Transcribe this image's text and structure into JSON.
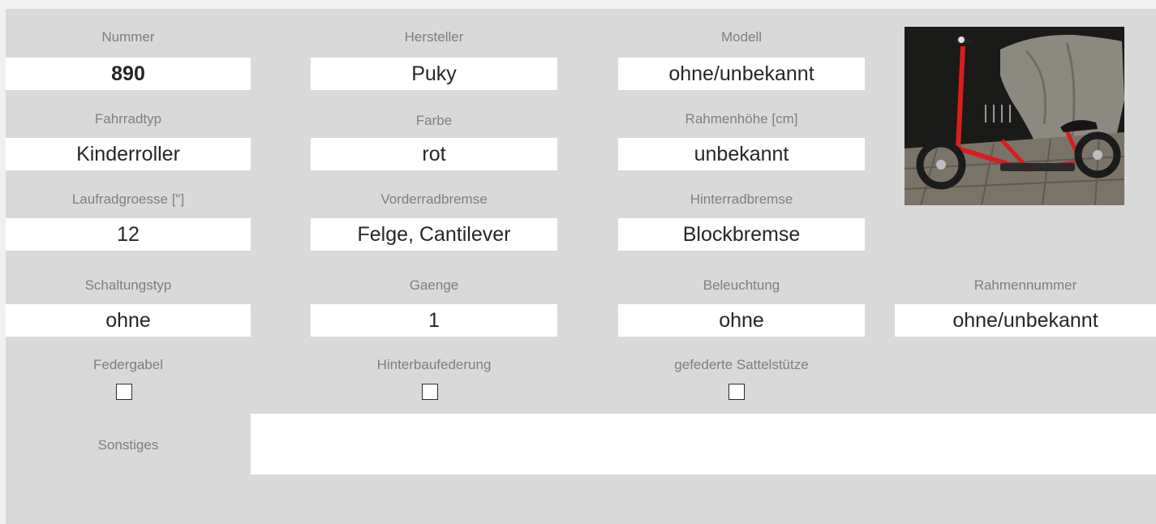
{
  "row1": {
    "nummer_label": "Nummer",
    "nummer_value": "890",
    "hersteller_label": "Hersteller",
    "hersteller_value": "Puky",
    "modell_label": "Modell",
    "modell_value": "ohne/unbekannt"
  },
  "row2": {
    "fahrradtyp_label": "Fahrradtyp",
    "fahrradtyp_value": "Kinderroller",
    "farbe_label": "Farbe",
    "farbe_value": "rot",
    "rahmenhoehe_label": "Rahmenhöhe [cm]",
    "rahmenhoehe_value": "unbekannt"
  },
  "row3": {
    "laufrad_label": "Laufradgroesse [\"]",
    "laufrad_value": "12",
    "vorderrad_label": "Vorderradbremse",
    "vorderrad_value": "Felge, Cantilever",
    "hinterrad_label": "Hinterradbremse",
    "hinterrad_value": "Blockbremse"
  },
  "row4": {
    "schaltung_label": "Schaltungstyp",
    "schaltung_value": "ohne",
    "gaenge_label": "Gaenge",
    "gaenge_value": "1",
    "beleuchtung_label": "Beleuchtung",
    "beleuchtung_value": "ohne",
    "rahmennummer_label": "Rahmennummer",
    "rahmennummer_value": "ohne/unbekannt"
  },
  "row5": {
    "federgabel_label": "Federgabel",
    "federgabel_checked": false,
    "hinterbau_label": "Hinterbaufederung",
    "hinterbau_checked": false,
    "sattelstuetze_label": "gefederte Sattelstütze",
    "sattelstuetze_checked": false
  },
  "sonstiges": {
    "label": "Sonstiges",
    "value": ""
  },
  "photo": {
    "icon": "scooter-photo",
    "scooter_color": "#d81e1e",
    "background_color": "#1a1a18"
  }
}
